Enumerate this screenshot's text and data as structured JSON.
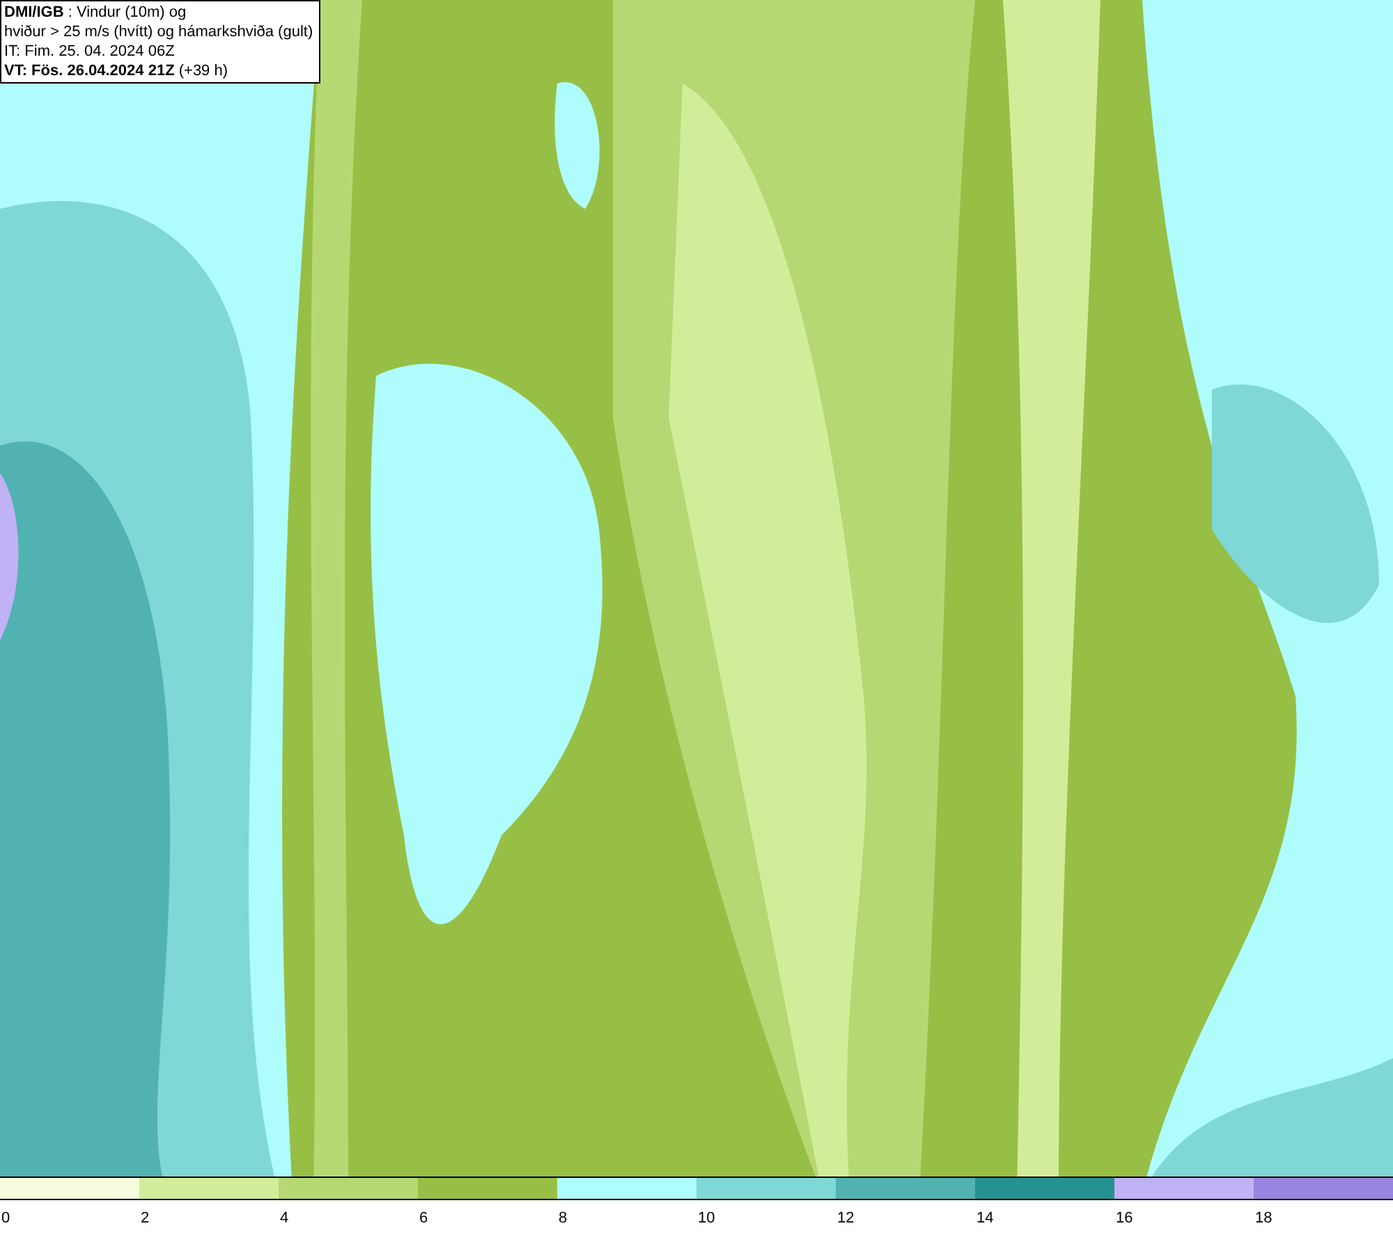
{
  "header": {
    "lines": [
      "**DMI/IGB** : Vindur (10m) og",
      "hviður > 25 m/s (hvítt) og hámarkshviða (gult)",
      "IT: Fim. 25. 04. 2024 06Z",
      "**VT: Fös. 26.04.2024 21Z** (+39 h)"
    ]
  },
  "legend": [
    {
      "label": "0",
      "color": "#f5fbdc"
    },
    {
      "label": "2",
      "color": "#d3ec9a"
    },
    {
      "label": "4",
      "color": "#b6d873"
    },
    {
      "label": "6",
      "color": "#97bf45"
    },
    {
      "label": "8",
      "color": "#aefcfc"
    },
    {
      "label": "10",
      "color": "#7fd7d6"
    },
    {
      "label": "12",
      "color": "#52b2b2"
    },
    {
      "label": "14",
      "color": "#259190"
    },
    {
      "label": "16",
      "color": "#c0b2f5"
    },
    {
      "label": "18",
      "color": "#9a86e0"
    }
  ]
}
